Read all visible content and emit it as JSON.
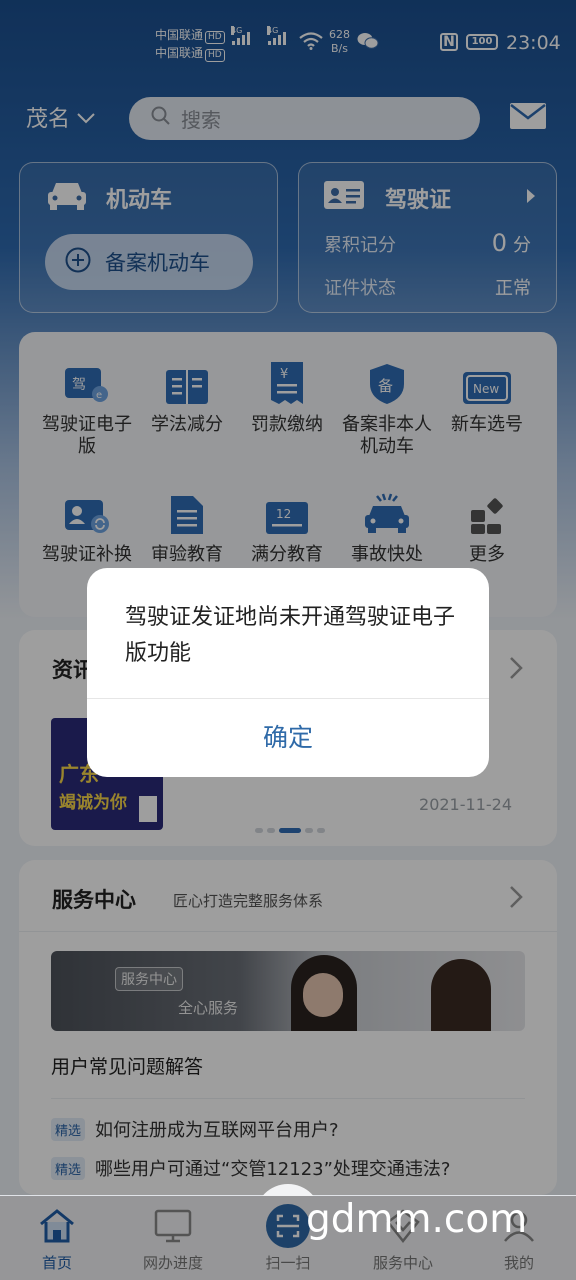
{
  "status_bar": {
    "carrier1": "中国联通",
    "carrier2": "中国联通",
    "hd": "HD",
    "net1": "4G",
    "net2": "4G",
    "speed_value": "628",
    "speed_unit": "B/s",
    "battery": "100",
    "time": "23:04"
  },
  "header": {
    "city": "茂名",
    "search_placeholder": "搜索"
  },
  "vehicle_card": {
    "title": "机动车",
    "register_button": "备案机动车"
  },
  "license_card": {
    "title": "驾驶证",
    "points_label": "累积记分",
    "points_value": "0",
    "points_unit": "分",
    "status_label": "证件状态",
    "status_value": "正常"
  },
  "services": {
    "items": [
      {
        "label": "驾驶证电子版"
      },
      {
        "label": "学法减分"
      },
      {
        "label": "罚款缴纳"
      },
      {
        "label": "备案非本人机动车"
      },
      {
        "label": "新车选号"
      },
      {
        "label": "驾驶证补换"
      },
      {
        "label": "审验教育"
      },
      {
        "label": "满分教育"
      },
      {
        "label": "事故快处"
      },
      {
        "label": "更多"
      }
    ],
    "icon_texts": {
      "jia": "驾",
      "bei": "备",
      "new": "New",
      "twelve": "12",
      "yen": "¥"
    }
  },
  "news": {
    "title": "资讯",
    "date": "2021-11-24",
    "image_text1": "广东",
    "image_text2": "竭诚为你"
  },
  "service_center": {
    "title": "服务中心",
    "subtitle": "匠心打造完整服务体系",
    "banner_tag": "服务中心",
    "banner_slogan": "全心服务",
    "faq_title": "用户常见问题解答",
    "faq_items": [
      {
        "badge": "精选",
        "text": "如何注册成为互联网平台用户?"
      },
      {
        "badge": "精选",
        "text": "哪些用户可通过“交管12123”处理交通违法?"
      }
    ]
  },
  "tabbar": {
    "tabs": [
      {
        "label": "首页"
      },
      {
        "label": "网办进度"
      },
      {
        "label": "扫一扫"
      },
      {
        "label": "服务中心"
      },
      {
        "label": "我的"
      }
    ]
  },
  "watermark": "gdmm.com",
  "dialog": {
    "message": "驾驶证发证地尚未开通驾驶证电子版功能",
    "confirm_label": "确定"
  },
  "colors": {
    "brand_blue": "#1b4f8f",
    "accent": "#2f6aa8",
    "overlay": "rgba(0,0,0,0.38)"
  }
}
